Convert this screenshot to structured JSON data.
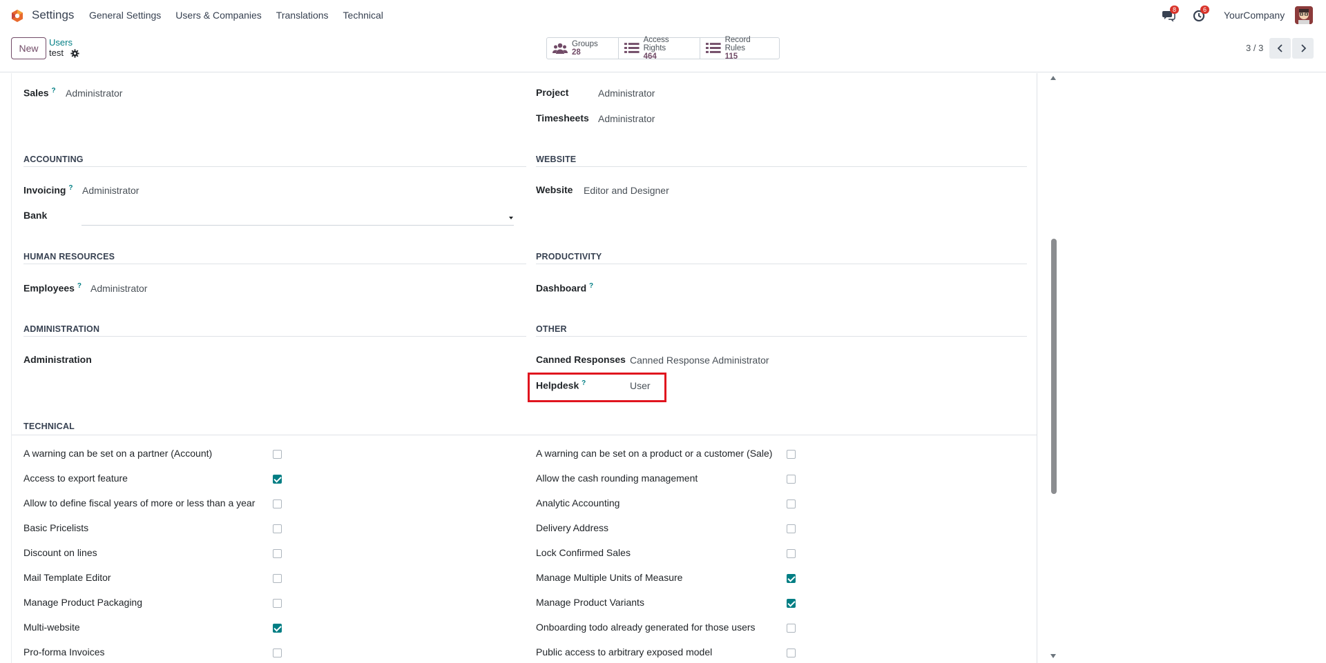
{
  "navbar": {
    "app_name": "Settings",
    "menu": [
      "General Settings",
      "Users & Companies",
      "Translations",
      "Technical"
    ],
    "messages_badge": "8",
    "activities_badge": "6",
    "company": "YourCompany"
  },
  "control_panel": {
    "new_label": "New",
    "breadcrumb_parent": "Users",
    "breadcrumb_current": "test",
    "stats": [
      {
        "label": "Groups",
        "value": "28",
        "icon": "users-icon"
      },
      {
        "label": "Access Rights",
        "value": "464",
        "icon": "list-icon"
      },
      {
        "label": "Record Rules",
        "value": "115",
        "icon": "list-icon"
      }
    ],
    "pager": "3 / 3"
  },
  "fields": {
    "sales_label": "Sales",
    "sales_value": "Administrator",
    "project_label": "Project",
    "project_value": "Administrator",
    "timesheets_label": "Timesheets",
    "timesheets_value": "Administrator",
    "accounting_section": "ACCOUNTING",
    "invoicing_label": "Invoicing",
    "invoicing_value": "Administrator",
    "bank_label": "Bank",
    "website_section": "WEBSITE",
    "website_label": "Website",
    "website_value": "Editor and Designer",
    "hr_section": "HUMAN RESOURCES",
    "employees_label": "Employees",
    "employees_value": "Administrator",
    "productivity_section": "PRODUCTIVITY",
    "dashboard_label": "Dashboard",
    "admin_section": "ADMINISTRATION",
    "administration_label": "Administration",
    "other_section": "OTHER",
    "canned_label": "Canned Responses",
    "canned_value": "Canned Response Administrator",
    "helpdesk_label": "Helpdesk",
    "helpdesk_value": "User",
    "technical_section": "TECHNICAL",
    "help_mark": "?"
  },
  "technical_left": [
    {
      "label": "A warning can be set on a partner (Account)",
      "checked": false
    },
    {
      "label": "Access to export feature",
      "checked": true
    },
    {
      "label": "Allow to define fiscal years of more or less than a year",
      "checked": false
    },
    {
      "label": "Basic Pricelists",
      "checked": false
    },
    {
      "label": "Discount on lines",
      "checked": false
    },
    {
      "label": "Mail Template Editor",
      "checked": false
    },
    {
      "label": "Manage Product Packaging",
      "checked": false
    },
    {
      "label": "Multi-website",
      "checked": true
    },
    {
      "label": "Pro-forma Invoices",
      "checked": false
    }
  ],
  "technical_right": [
    {
      "label": "A warning can be set on a product or a customer (Sale)",
      "checked": false
    },
    {
      "label": "Allow the cash rounding management",
      "checked": false
    },
    {
      "label": "Analytic Accounting",
      "checked": false
    },
    {
      "label": "Delivery Address",
      "checked": false
    },
    {
      "label": "Lock Confirmed Sales",
      "checked": false
    },
    {
      "label": "Manage Multiple Units of Measure",
      "checked": true
    },
    {
      "label": "Manage Product Variants",
      "checked": true
    },
    {
      "label": "Onboarding todo already generated for those users",
      "checked": false
    },
    {
      "label": "Public access to arbitrary exposed model",
      "checked": false
    }
  ],
  "colors": {
    "brand": "#714b67",
    "accent": "#017e84",
    "highlight": "#e0141e",
    "badge": "#d9342b"
  }
}
